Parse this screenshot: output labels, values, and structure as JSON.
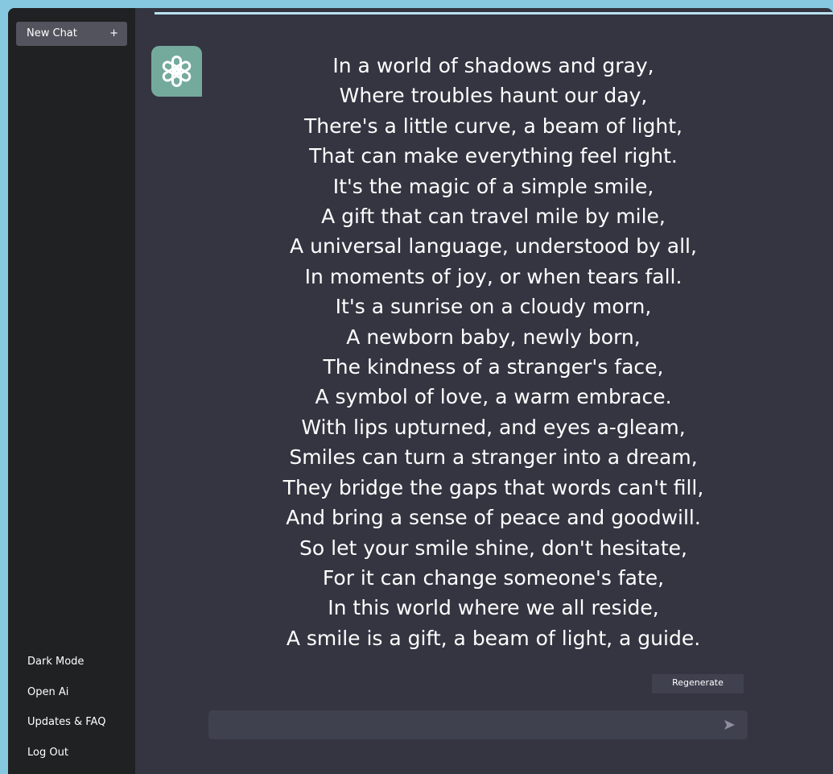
{
  "sidebar": {
    "new_chat": {
      "label": "New Chat",
      "icon": "plus-icon",
      "icon_glyph": "+"
    },
    "links": [
      {
        "label": "Dark Mode"
      },
      {
        "label": "Open Ai"
      },
      {
        "label": "Updates & FAQ"
      },
      {
        "label": "Log Out"
      }
    ]
  },
  "message": {
    "avatar_icon": "openai-logo-icon",
    "lines": [
      "In a world of shadows and gray,",
      "Where troubles haunt our day,",
      "There's a little curve, a beam of light,",
      "That can make everything feel right.",
      "It's the magic of a simple smile,",
      "A gift that can travel mile by mile,",
      "A universal language, understood by all,",
      "In moments of joy, or when tears fall.",
      "It's a sunrise on a cloudy morn,",
      "A newborn baby, newly born,",
      "The kindness of a stranger's face,",
      "A symbol of love, a warm embrace.",
      "With lips upturned, and eyes a-gleam,",
      "Smiles can turn a stranger into a dream,",
      "They bridge the gaps that words can't fill,",
      "And bring a sense of peace and goodwill.",
      "So let your smile shine, don't hesitate,",
      "For it can change someone's fate,",
      "In this world where we all reside,",
      "A smile is a gift, a beam of light, a guide."
    ]
  },
  "regenerate": {
    "label": "Regenerate"
  },
  "composer": {
    "value": "",
    "placeholder": "",
    "send_icon": "send-icon"
  },
  "colors": {
    "page_background": "#86c8e0",
    "sidebar": "#202123",
    "main": "#343541",
    "new_chat_button": "#52535c",
    "input": "#40414f",
    "avatar": "#74aa9c",
    "text": "#ffffff"
  }
}
